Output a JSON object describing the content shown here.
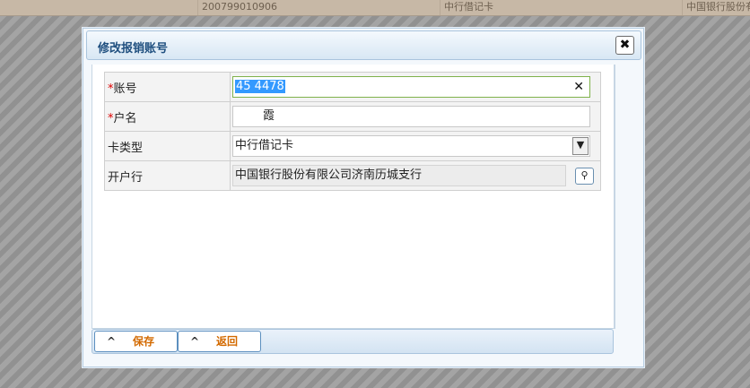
{
  "background": {
    "row": [
      "200799010906",
      "中行借记卡",
      "中国银行股份有"
    ]
  },
  "dialog": {
    "title": "修改报销账号",
    "close_glyph": "✖",
    "fields": {
      "account": {
        "label": "账号",
        "required": "*",
        "value": "45       4478",
        "clear_glyph": "✕"
      },
      "name": {
        "label": "户名",
        "required": "*",
        "value": "        霞"
      },
      "card_type": {
        "label": "卡类型",
        "value": "中行借记卡"
      },
      "bank": {
        "label": "开户行",
        "value": "中国银行股份有限公司济南历城支行"
      }
    },
    "buttons": {
      "save": "保存",
      "back": "返回",
      "caret": "^"
    }
  },
  "colors": {
    "accent": "#5c8fbf",
    "button_text": "#d36a00",
    "required": "#dd0000"
  }
}
